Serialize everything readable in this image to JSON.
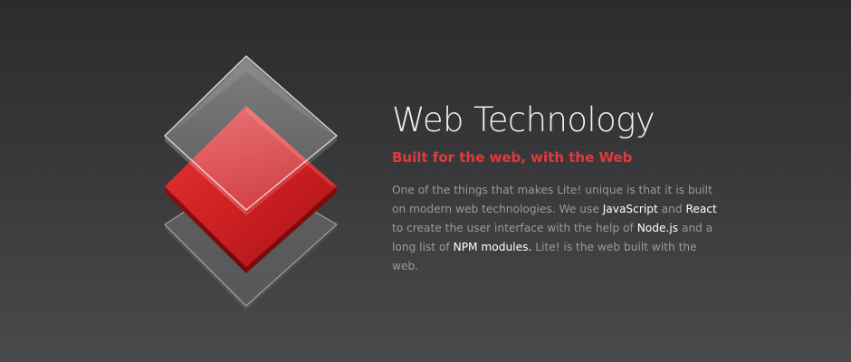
{
  "hero": {
    "title": "Web Technology",
    "subtitle": "Built for the web, with the Web",
    "body": {
      "part1": "One of the things that makes Lite! unique is that it is built on modern web technologies. We use ",
      "highlight1": "JavaScript",
      "part2": " and ",
      "highlight2": "React",
      "part3": " to create the user interface with the help of ",
      "highlight3": "Node.js",
      "part4": " and a long list of ",
      "highlight4": "NPM modules.",
      "part5": " Lite! is the web built with the web."
    }
  },
  "illustration": {
    "icon": "stacked-layers-icon",
    "colors": {
      "accent_red": "#d9292b",
      "glass": "#ffffff"
    }
  },
  "colors": {
    "background_top": "#2c2c2e",
    "background_bottom": "#4a4a4d",
    "title": "#f1f1f1",
    "subtitle": "#e23a3a",
    "body": "#9a9a9d",
    "highlight": "#ffffff"
  }
}
